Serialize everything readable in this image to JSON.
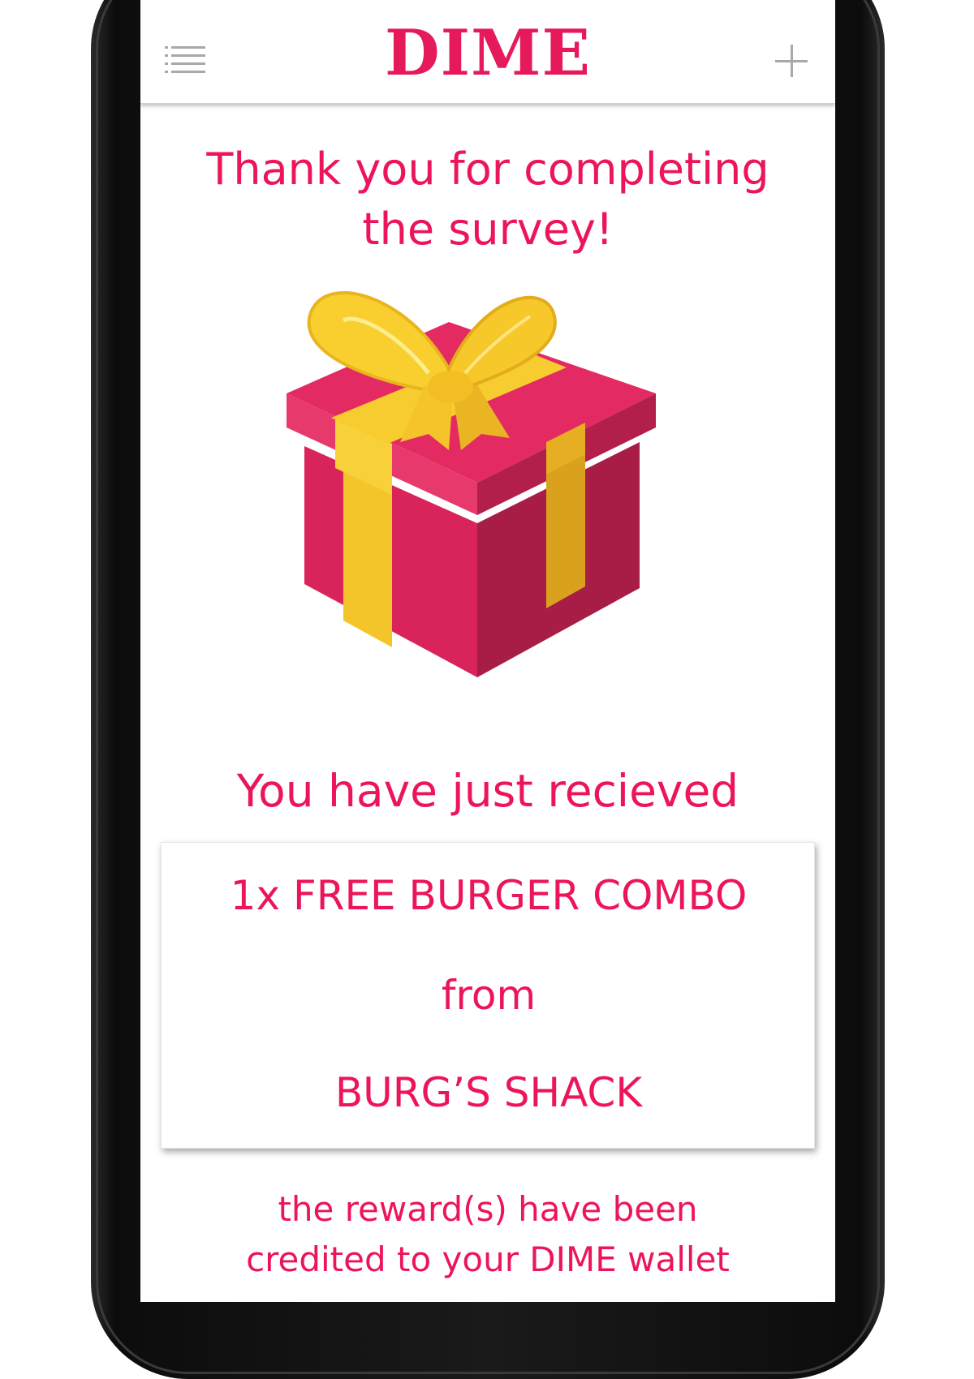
{
  "header": {
    "brand": "DIME",
    "menu_icon": "list-icon",
    "add_icon": "plus-icon"
  },
  "main": {
    "thanks_line1": "Thank you for completing",
    "thanks_line2": "the survey!",
    "gift_image": "gift-box-icon",
    "received_label": "You have just recieved",
    "reward": {
      "item": "1x FREE BURGER COMBO",
      "from_label": "from",
      "merchant": "BURG’S SHACK"
    },
    "note_line1": "the reward(s) have been",
    "note_line2": "credited to your DIME wallet"
  },
  "colors": {
    "accent": "#ed1559",
    "brand": "#e6195a",
    "gift_red": "#e0245e",
    "ribbon_yellow": "#f7c52a"
  }
}
